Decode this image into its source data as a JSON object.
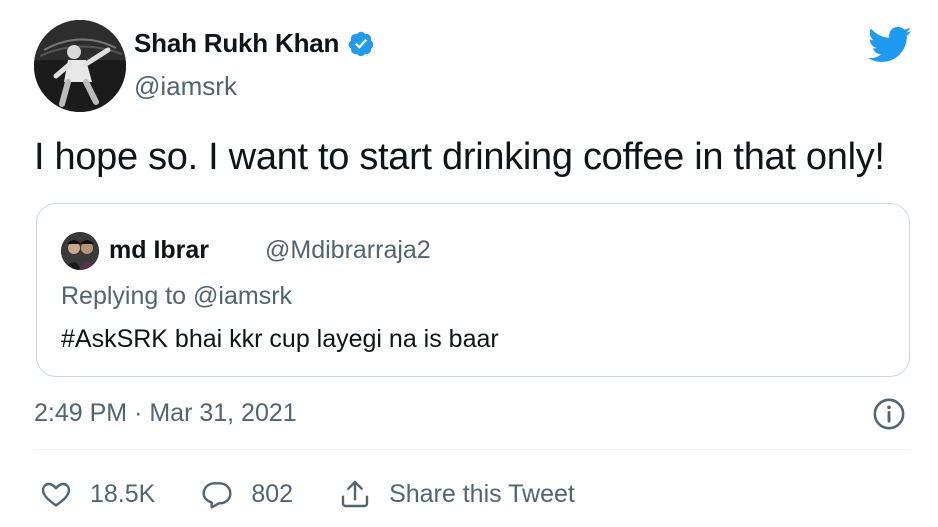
{
  "author": {
    "display_name": "Shah Rukh Khan",
    "handle": "@iamsrk",
    "verified": true
  },
  "tweet": {
    "text": "I hope so. I want to start drinking coffee in that only!",
    "time": "2:49 PM",
    "separator": "·",
    "date": "Mar 31, 2021"
  },
  "quoted": {
    "display_name": "md Ibrar",
    "handle": "@Mdibrarraja2",
    "replying_to_prefix": "Replying to",
    "replying_to_handle": "@iamsrk",
    "text": "#AskSRK bhai kkr cup layegi na is baar"
  },
  "actions": {
    "likes": "18.5K",
    "replies": "802",
    "share_label": "Share this Tweet"
  },
  "colors": {
    "brand_blue": "#1d9bf0",
    "text_primary": "#0f1419",
    "text_secondary": "#536471",
    "border": "#cfd9de"
  },
  "icons": [
    "twitter-bird-icon",
    "verified-badge-icon",
    "info-icon",
    "heart-icon",
    "reply-icon",
    "share-icon"
  ]
}
